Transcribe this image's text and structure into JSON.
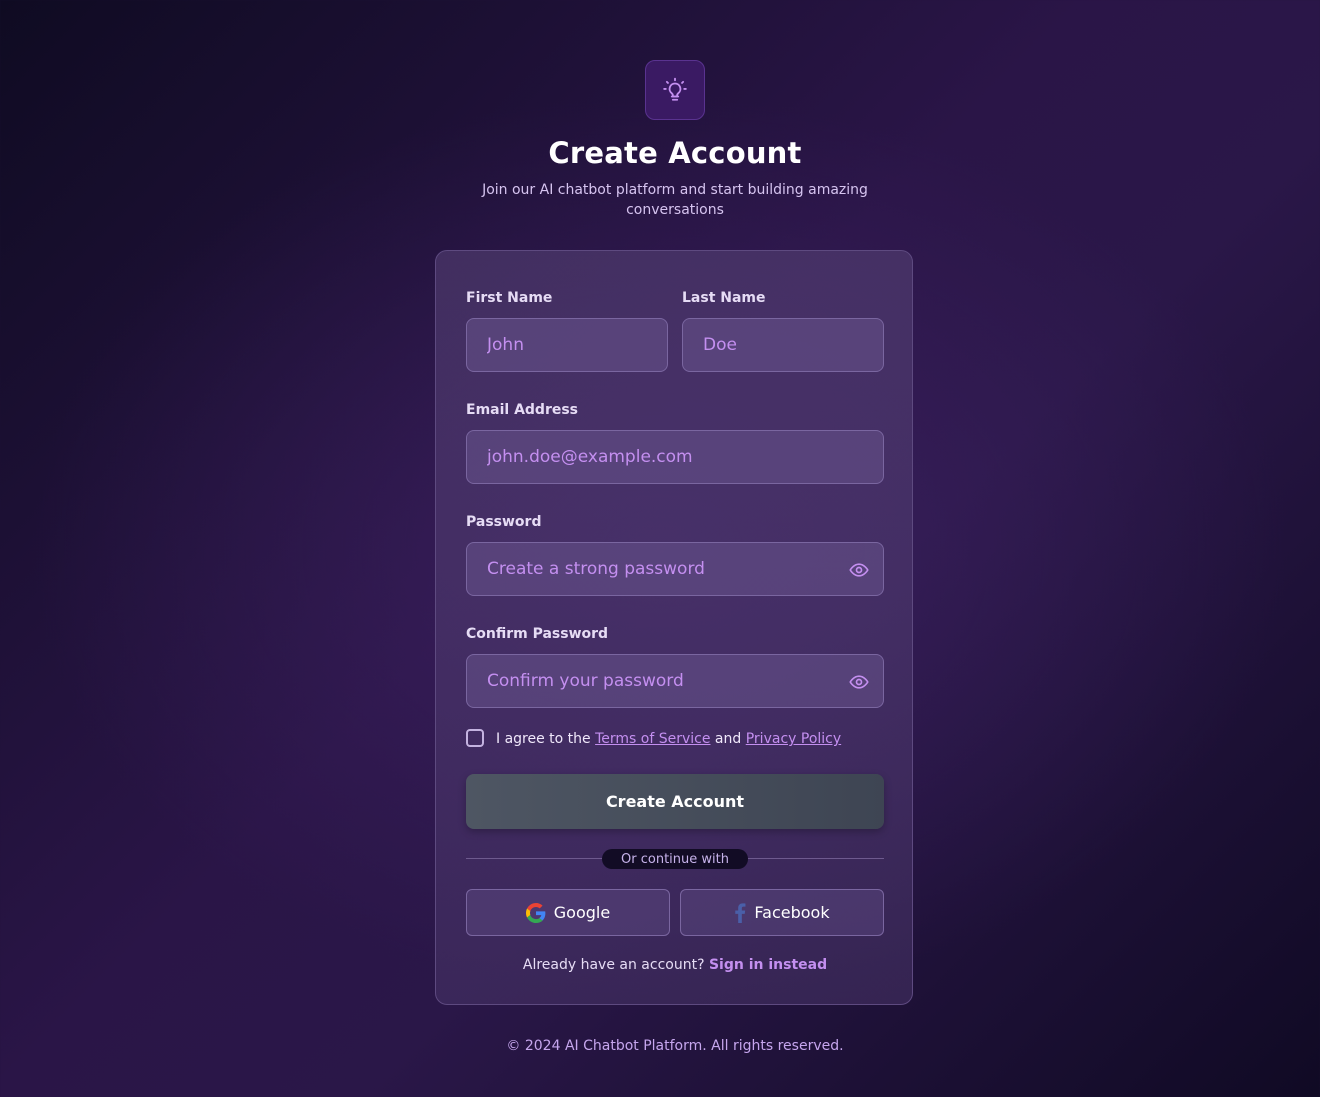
{
  "header": {
    "logo_icon": "lightbulb-icon",
    "title": "Create Account",
    "subtitle": "Join our AI chatbot platform and start building amazing conversations"
  },
  "form": {
    "first_name": {
      "label": "First Name",
      "placeholder": "John",
      "value": ""
    },
    "last_name": {
      "label": "Last Name",
      "placeholder": "Doe",
      "value": ""
    },
    "email": {
      "label": "Email Address",
      "placeholder": "john.doe@example.com",
      "value": ""
    },
    "password": {
      "label": "Password",
      "placeholder": "Create a strong password",
      "value": "",
      "toggle_icon": "eye-icon"
    },
    "confirm_password": {
      "label": "Confirm Password",
      "placeholder": "Confirm your password",
      "value": "",
      "toggle_icon": "eye-icon"
    },
    "agree": {
      "checked": false,
      "prefix": "I agree to the ",
      "terms_link": "Terms of Service",
      "middle": " and ",
      "privacy_link": "Privacy Policy"
    },
    "submit_label": "Create Account"
  },
  "divider_text": "Or continue with",
  "social": {
    "google_label": "Google",
    "google_icon": "google-icon",
    "facebook_label": "Facebook",
    "facebook_icon": "facebook-icon"
  },
  "signin": {
    "prompt": "Already have an account? ",
    "link": "Sign in instead"
  },
  "footer": "© 2024 AI Chatbot Platform. All rights reserved.",
  "colors": {
    "accent": "#c48ff0",
    "logo_bg": "#3a1a63",
    "button_bg": "#4e5663"
  }
}
